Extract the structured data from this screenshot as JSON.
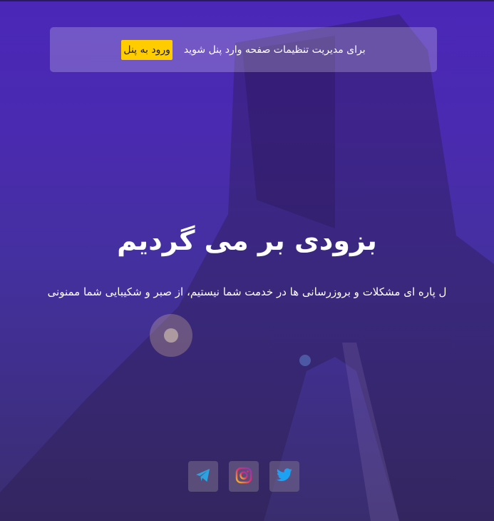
{
  "notice": {
    "text": "برای مدیریت تنظیمات صفحه وارد پنل شوید",
    "button_label": "ورود به پنل"
  },
  "hero": {
    "title": "بزودی بر می گردیم",
    "subtitle": "ل پاره ای مشکلات و بروزرسانی ها در خدمت شما نیستیم، از صبر و شکیبایی شما ممنونی"
  },
  "social": [
    {
      "icon": "telegram-icon",
      "color": "#2aa3e0"
    },
    {
      "icon": "instagram-icon",
      "color": "#e1306c"
    },
    {
      "icon": "twitter-icon",
      "color": "#1da1f2"
    }
  ],
  "colors": {
    "accent_button": "#ffcc00",
    "background": "#4b27b8"
  }
}
